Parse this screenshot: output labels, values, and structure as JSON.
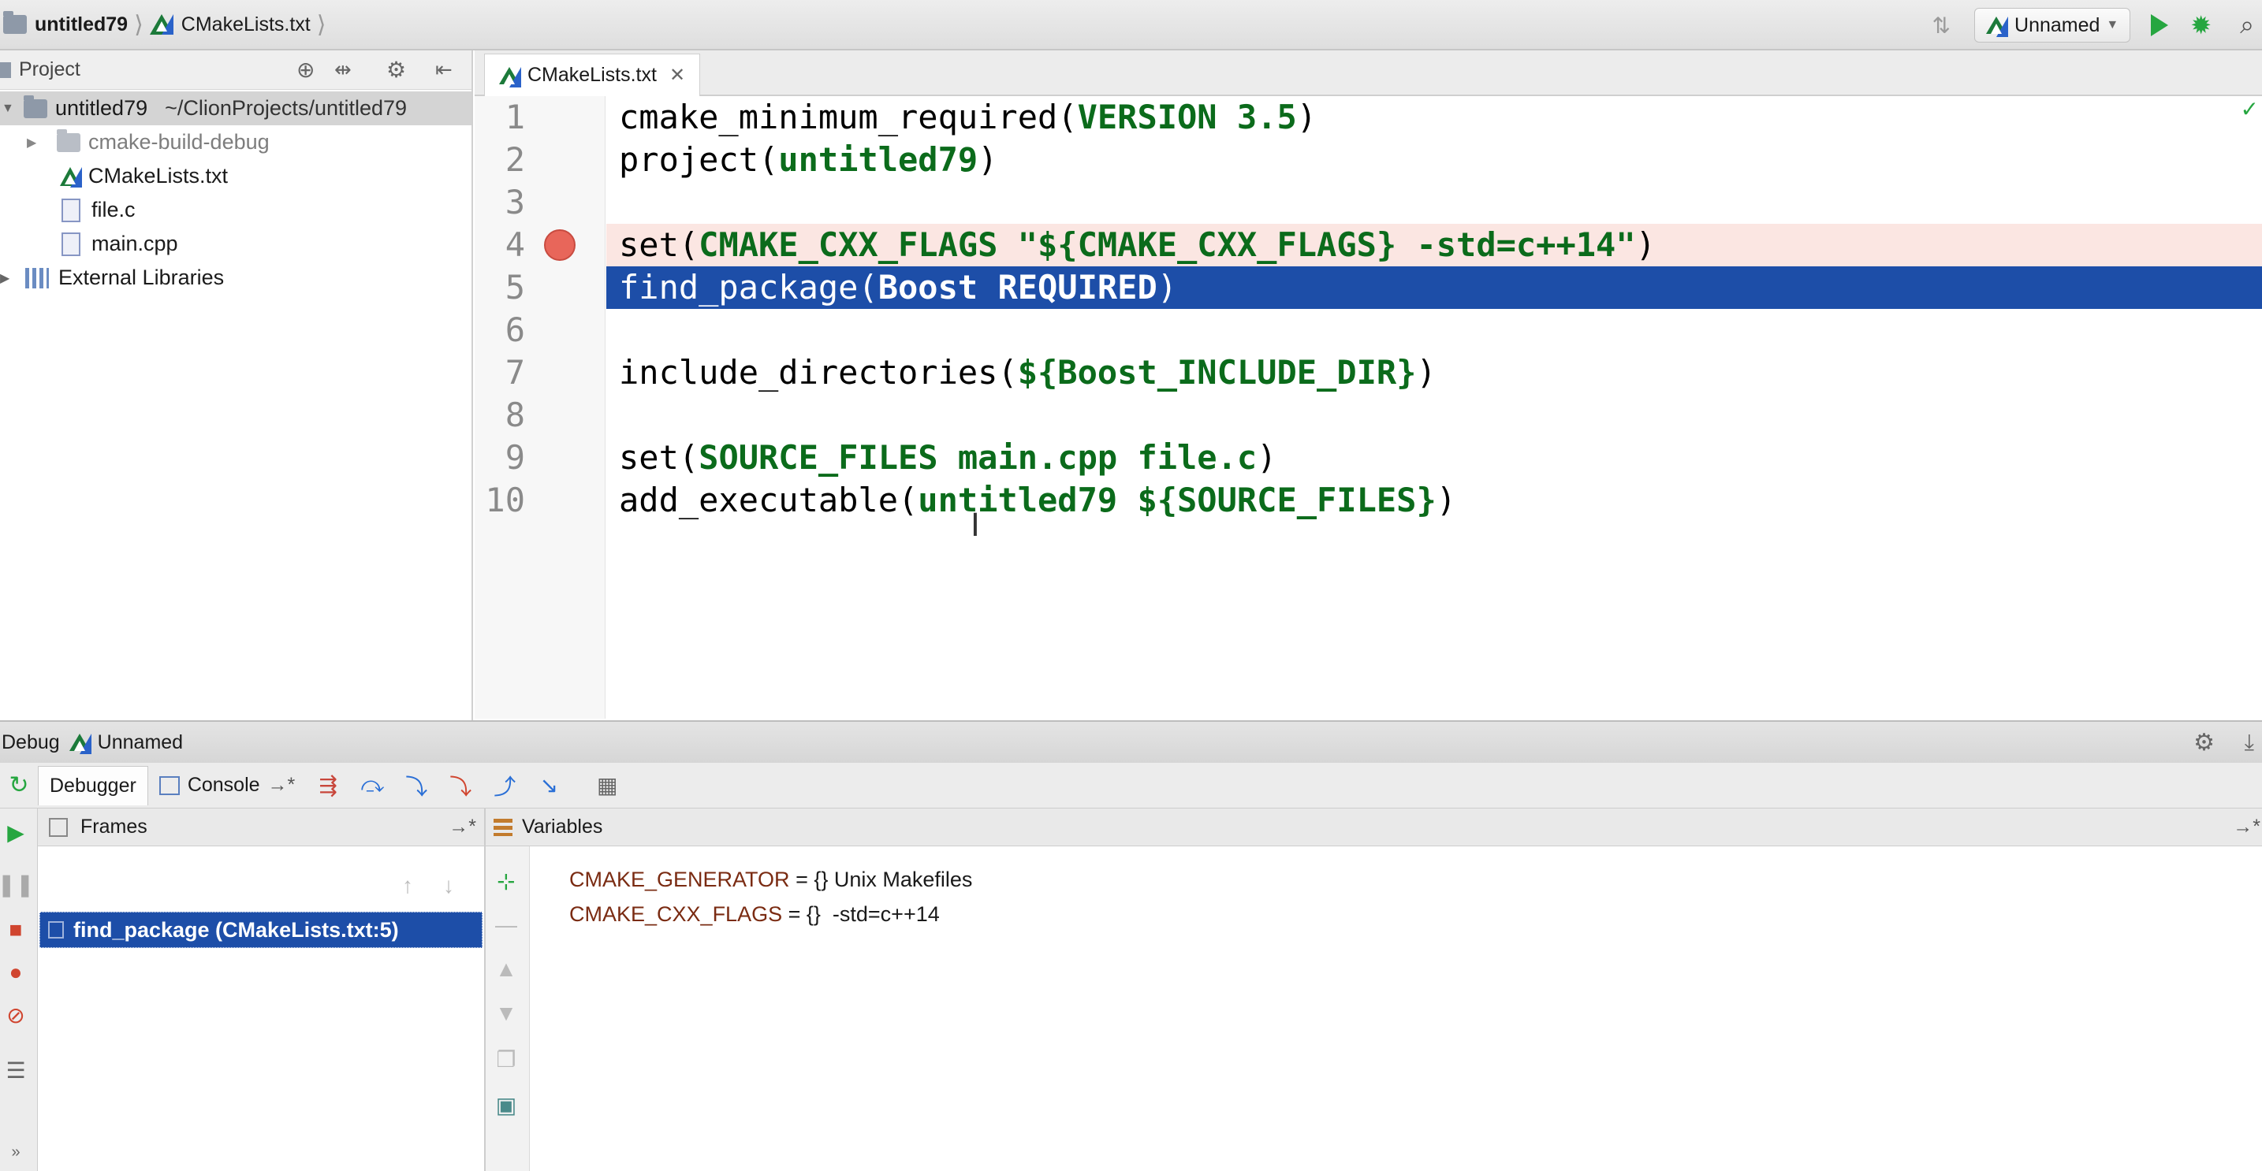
{
  "navbar": {
    "project": "untitled79",
    "file": "CMakeLists.txt",
    "run_config": "Unnamed",
    "icons": [
      "folder-icon",
      "cmake-icon",
      "build-icon",
      "run-icon",
      "debug-icon",
      "search-icon"
    ]
  },
  "project_pane": {
    "title": "Project",
    "root": "untitled79",
    "root_path": "~/ClionProjects/untitled79",
    "items": [
      {
        "label": "cmake-build-debug",
        "type": "folder"
      },
      {
        "label": "CMakeLists.txt",
        "type": "cmake"
      },
      {
        "label": "file.c",
        "type": "c"
      },
      {
        "label": "main.cpp",
        "type": "cpp"
      },
      {
        "label": "External Libraries",
        "type": "libraries"
      }
    ]
  },
  "editor": {
    "tab": "CMakeLists.txt",
    "lines": [
      {
        "n": "1",
        "code": "cmake_minimum_required(",
        "arg": "VERSION 3.5",
        "tail": ")"
      },
      {
        "n": "2",
        "code": "project(",
        "arg": "untitled79",
        "tail": ")"
      },
      {
        "n": "3",
        "code": "",
        "arg": "",
        "tail": ""
      },
      {
        "n": "4",
        "code": "set(",
        "arg": "CMAKE_CXX_FLAGS \"${CMAKE_CXX_FLAGS} -std=c++14\"",
        "tail": ")"
      },
      {
        "n": "5",
        "code": "find_package(",
        "arg": "Boost REQUIRED",
        "tail": ")"
      },
      {
        "n": "6",
        "code": "",
        "arg": "",
        "tail": ""
      },
      {
        "n": "7",
        "code": "include_directories(",
        "arg": "${Boost_INCLUDE_DIR}",
        "tail": ")"
      },
      {
        "n": "8",
        "code": "",
        "arg": "",
        "tail": ""
      },
      {
        "n": "9",
        "code": "set(",
        "arg": "SOURCE_FILES main.cpp file.c",
        "tail": ")"
      },
      {
        "n": "10",
        "code": "add_executable(",
        "arg": "untitled79 ${SOURCE_FILES}",
        "tail": ")"
      }
    ],
    "breakpoint_line": "4",
    "current_line": "5"
  },
  "debug": {
    "title": "Debug",
    "config": "Unnamed",
    "tabs": [
      "Debugger",
      "Console"
    ],
    "frames_title": "Frames",
    "variables_title": "Variables",
    "frame": "find_package (CMakeLists.txt:5)",
    "variables": [
      {
        "name": "CMAKE_GENERATOR",
        "eq": " = {} ",
        "value": "Unix Makefiles"
      },
      {
        "name": "CMAKE_CXX_FLAGS",
        "eq": " = {}  ",
        "value": "-std=c++14"
      }
    ]
  },
  "colors": {
    "selection": "#1d4ea8",
    "string_green": "#0b6b1b",
    "breakpoint": "#e8665a"
  }
}
